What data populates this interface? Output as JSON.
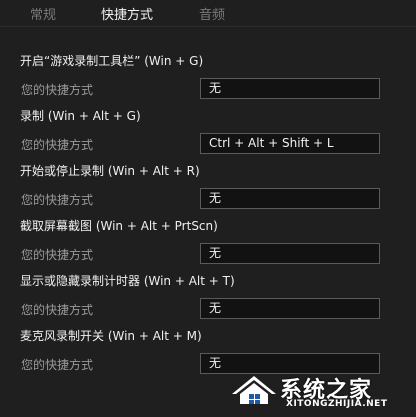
{
  "tabs": [
    {
      "label": "常规",
      "active": false
    },
    {
      "label": "快捷方式",
      "active": true
    },
    {
      "label": "音频",
      "active": false
    }
  ],
  "sections": [
    {
      "title": "开启“游戏录制工具栏” (Win + G)",
      "row_label": "您的快捷方式",
      "value": "无"
    },
    {
      "title": "录制 (Win + Alt + G)",
      "row_label": "您的快捷方式",
      "value": "Ctrl + Alt + Shift + L"
    },
    {
      "title": "开始或停止录制 (Win + Alt + R)",
      "row_label": "您的快捷方式",
      "value": "无"
    },
    {
      "title": "截取屏幕截图 (Win + Alt + PrtScn)",
      "row_label": "您的快捷方式",
      "value": "无"
    },
    {
      "title": "显示或隐藏录制计时器 (Win + Alt + T)",
      "row_label": "您的快捷方式",
      "value": "无"
    },
    {
      "title": "麦克风录制开关 (Win + Alt + M)",
      "row_label": "您的快捷方式",
      "value": "无"
    }
  ],
  "watermark": {
    "title": "系统之家",
    "url": "XITONGZHIJIA.NET"
  },
  "colors": {
    "background": "#1f1f1f",
    "field_border": "#5a5a5a",
    "tab_inactive": "#7a7a7a"
  }
}
